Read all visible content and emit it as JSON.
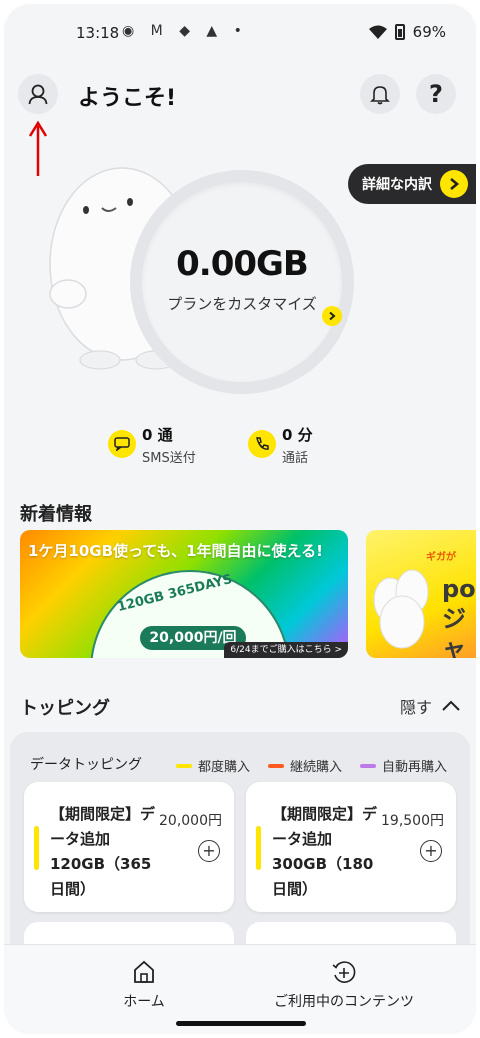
{
  "status_bar": {
    "time": "13:18",
    "left_icons": "◉ M ◆ ▲ •",
    "battery": "69%"
  },
  "header": {
    "welcome": "ようこそ!"
  },
  "detail_link": {
    "label": "詳細な内訳"
  },
  "usage": {
    "data_value": "0.00GB",
    "customize_link": "プランをカスタマイズ"
  },
  "counters": {
    "sms": {
      "value": "0 通",
      "label": "SMS送付"
    },
    "call": {
      "value": "0 分",
      "label": "通話"
    }
  },
  "news": {
    "title": "新着情報",
    "banner1": {
      "headline": "1ケ月10GB使っても、1年間自由に使える!",
      "badge": "120GB 365DAYS",
      "price": "20,000円/回",
      "cta": "6/24までご購入はこちら >"
    },
    "banner2": {
      "tag": "ギガが",
      "text": "po ジャ"
    }
  },
  "topping": {
    "title": "トッピング",
    "hide_label": "隠す",
    "data_topping_label": "データトッピング",
    "legend": [
      {
        "label": "都度購入",
        "color": "#ffe500"
      },
      {
        "label": "継続購入",
        "color": "#ff5a1f"
      },
      {
        "label": "自動再購入",
        "color": "#c07ae8"
      }
    ],
    "cards": [
      {
        "title": "【期間限定】データ追加120GB（365日間）",
        "price": "20,000円"
      },
      {
        "title": "【期間限定】データ追加300GB（180日間）",
        "price": "19,500円"
      }
    ]
  },
  "bottom_nav": {
    "home": "ホーム",
    "contents": "ご利用中のコンテンツ"
  }
}
